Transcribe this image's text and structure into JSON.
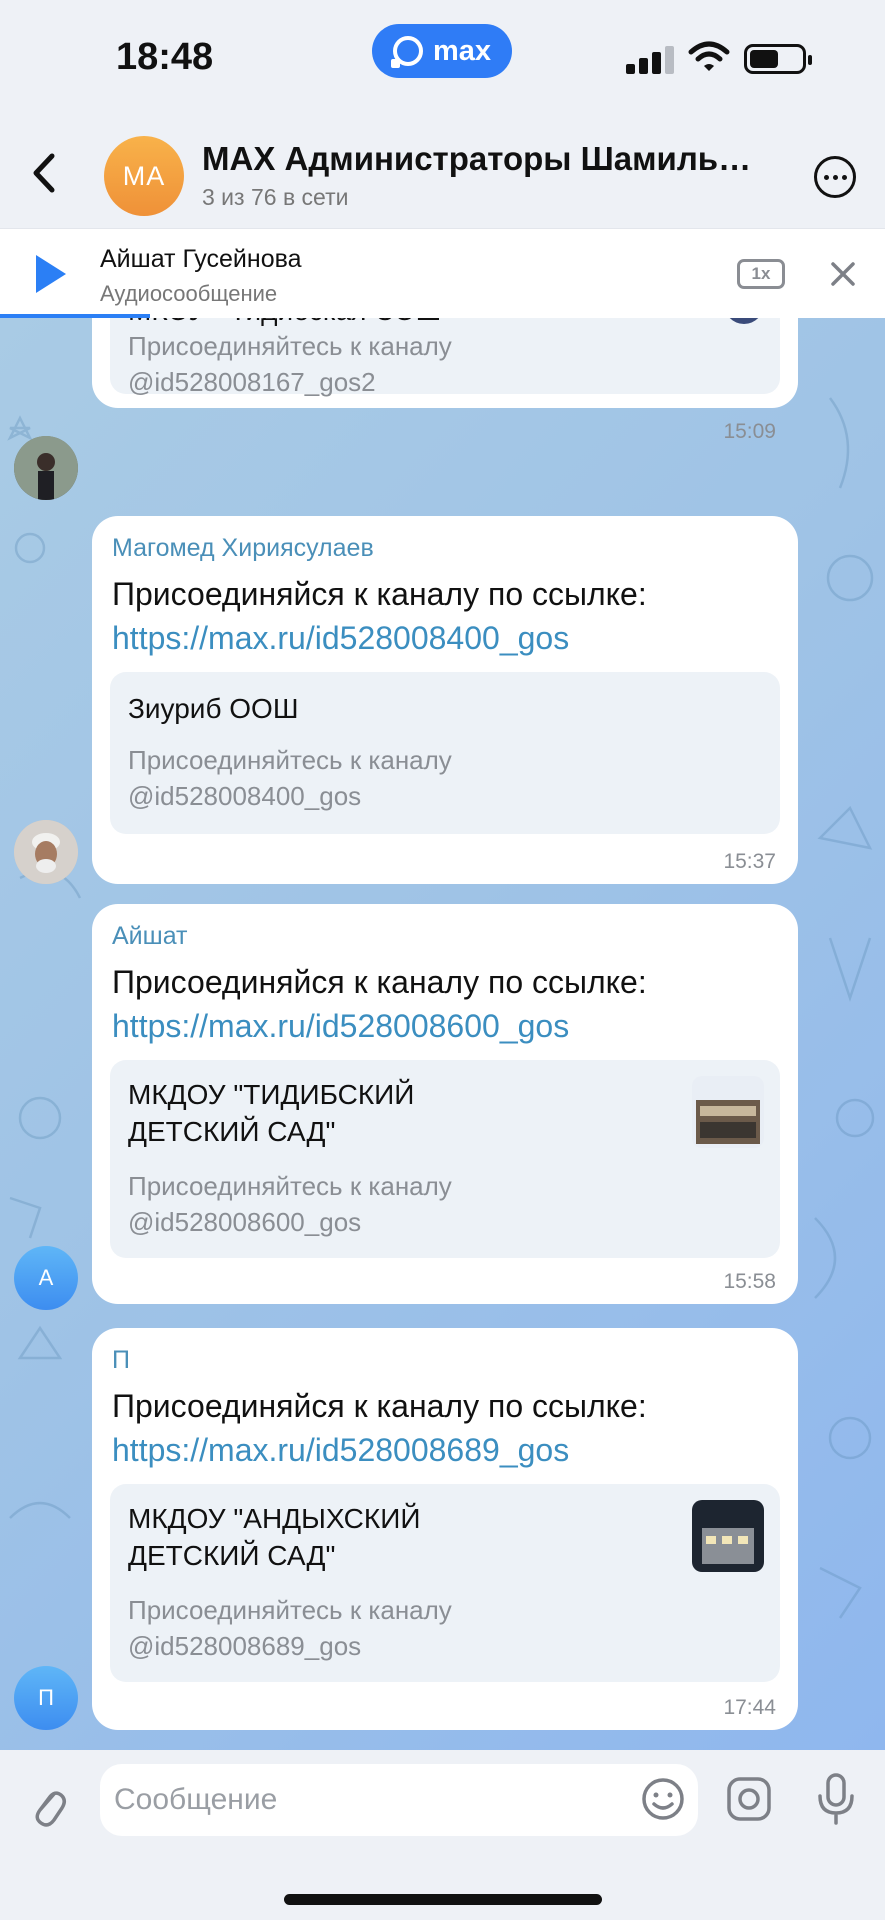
{
  "status_bar": {
    "time": "18:48",
    "app_badge": "max"
  },
  "header": {
    "avatar_initials": "MA",
    "title": "MAX Администраторы Шамиль…",
    "subtitle": "3 из 76 в сети"
  },
  "audio": {
    "name": "Айшат Гусейнова",
    "type": "Аудиосообщение",
    "speed": "1x",
    "progress": 0.17
  },
  "messages": [
    {
      "partial_title": "МКОУ «Тидибская СОШ»",
      "preview_desc_1": "Присоединяйтесь к каналу",
      "preview_desc_2": "@id528008167_gos2",
      "time": "15:09"
    },
    {
      "sender": "Магомед Хириясулаев",
      "text": "Присоединяйся к каналу по ссылке:",
      "link": "https://max.ru/id528008400_gos",
      "preview_title": "Зиуриб ООШ",
      "preview_desc_1": "Присоединяйтесь к каналу",
      "preview_desc_2": "@id528008400_gos",
      "time": "15:37"
    },
    {
      "sender": "Айшат",
      "text": "Присоединяйся к каналу по ссылке:",
      "link": "https://max.ru/id528008600_gos",
      "preview_title": "МКДОУ \"ТИДИБСКИЙ\nДЕТСКИЙ САД\"",
      "preview_desc_1": "Присоединяйтесь к каналу",
      "preview_desc_2": "@id528008600_gos",
      "time": "15:58",
      "avatar_letter": "А"
    },
    {
      "sender": "П",
      "text": "Присоединяйся к каналу по ссылке:",
      "link": "https://max.ru/id528008689_gos",
      "preview_title": "МКДОУ \"АНДЫХСКИЙ\nДЕТСКИЙ САД\"",
      "preview_desc_1": "Присоединяйтесь к каналу",
      "preview_desc_2": "@id528008689_gos",
      "time": "17:44",
      "avatar_letter": "П"
    }
  ],
  "composer": {
    "placeholder": "Сообщение"
  },
  "colors": {
    "accent": "#2b7ff5",
    "link": "#3b8ec0",
    "sender": "#4a8fb8"
  }
}
